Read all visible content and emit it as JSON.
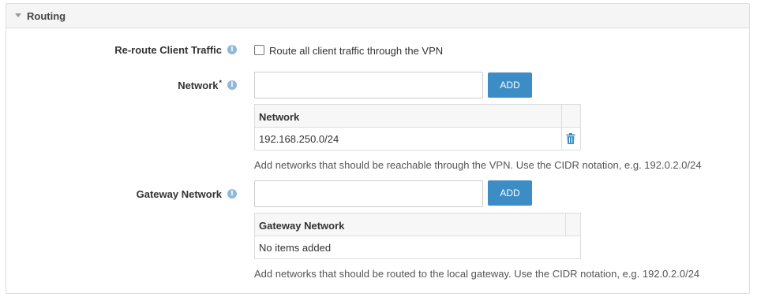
{
  "section": {
    "title": "Routing",
    "reroute": {
      "label": "Re-route Client Traffic",
      "checkbox_label": "Route all client traffic through the VPN",
      "checked": false
    },
    "network": {
      "label": "Network",
      "required_mark": "*",
      "input_value": "",
      "add_label": "ADD",
      "column_header": "Network",
      "rows": [
        "192.168.250.0/24"
      ],
      "help": "Add networks that should be reachable through the VPN. Use the CIDR notation, e.g. 192.0.2.0/24"
    },
    "gateway": {
      "label": "Gateway Network",
      "input_value": "",
      "add_label": "ADD",
      "column_header": "Gateway Network",
      "empty_text": "No items added",
      "help": "Add networks that should be routed to the local gateway. Use the CIDR notation, e.g. 192.0.2.0/24"
    }
  },
  "icons": {
    "info": "info-icon",
    "trash": "trash-icon",
    "collapse": "caret-down-icon"
  },
  "colors": {
    "accent": "#3c8dc5",
    "info": "#8eb8dc",
    "border": "#dddddd"
  }
}
